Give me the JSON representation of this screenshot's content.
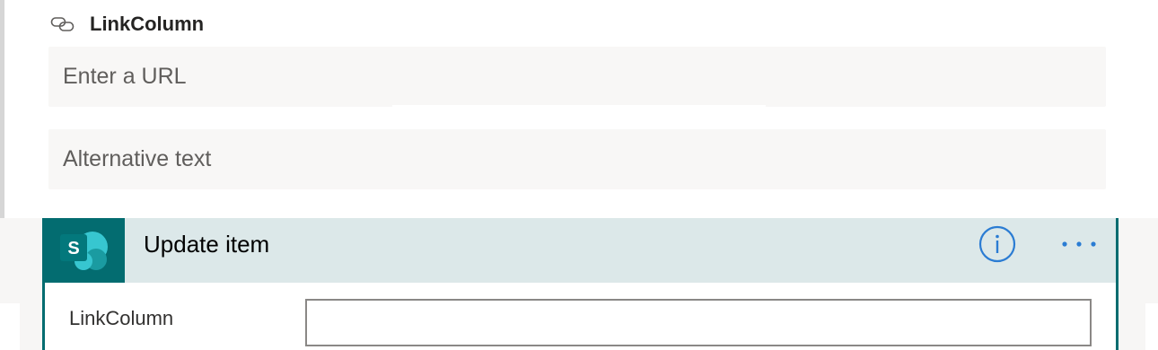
{
  "link_field": {
    "title": "LinkColumn",
    "icon": "link-icon",
    "url_placeholder": "Enter a URL",
    "alt_placeholder": "Alternative text"
  },
  "action": {
    "title": "Update item",
    "connector_icon": "sharepoint-icon",
    "connector_letter": "S",
    "info_icon": "info-icon",
    "more_icon": "more-options-icon",
    "field_label": "LinkColumn",
    "field_value": ""
  },
  "colors": {
    "sharepoint_teal": "#036c70",
    "header_bg": "#dce8e9",
    "accent_blue": "#2b7cd3"
  }
}
